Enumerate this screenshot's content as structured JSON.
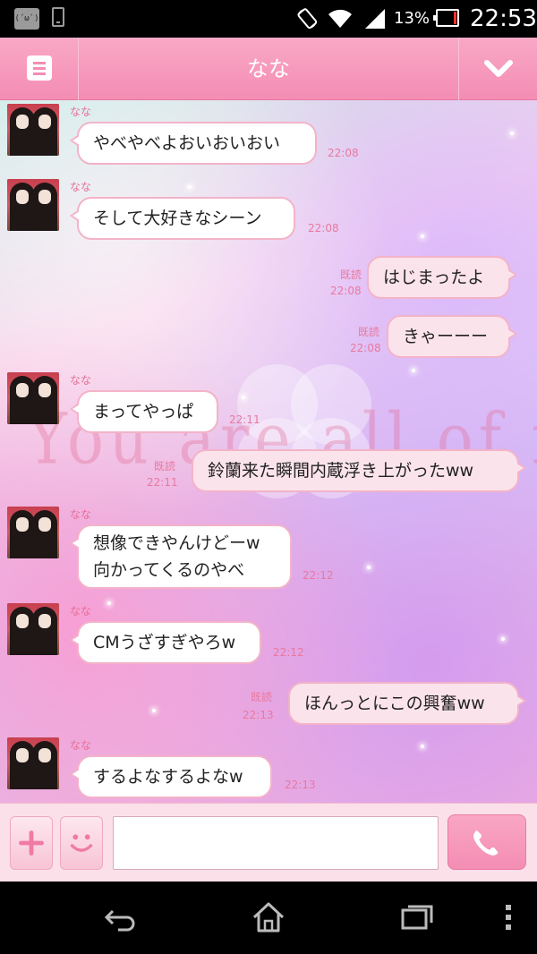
{
  "status_bar": {
    "face_icon_text": "(´ω`)",
    "battery_percent": "13%",
    "time": "22:53",
    "icons": [
      "face-notification-icon",
      "phone-icon",
      "rotate-icon",
      "wifi-icon",
      "signal-icon",
      "battery-icon"
    ]
  },
  "header": {
    "title": "なな",
    "menu_icon": "menu-icon",
    "dropdown_icon": "chevron-down-icon"
  },
  "chat": {
    "watermark_text": "You are all of me",
    "messages": [
      {
        "direction": "in",
        "sender": "なな",
        "lines": [
          "やべやべよおいおいおい"
        ],
        "time": "22:08"
      },
      {
        "direction": "in",
        "sender": "なな",
        "lines": [
          "そして大好きなシーン"
        ],
        "time": "22:08"
      },
      {
        "direction": "out",
        "read": "既読",
        "lines": [
          "はじまったよ"
        ],
        "time": "22:08"
      },
      {
        "direction": "out",
        "read": "既読",
        "lines": [
          "きゃーーー"
        ],
        "time": "22:08"
      },
      {
        "direction": "in",
        "sender": "なな",
        "lines": [
          "まってやっぱ"
        ],
        "time": "22:11"
      },
      {
        "direction": "out",
        "read": "既読",
        "lines": [
          "鈴蘭来た瞬間内蔵浮き上がったww"
        ],
        "time": "22:11"
      },
      {
        "direction": "in",
        "sender": "なな",
        "lines": [
          "想像できやんけどーw",
          "向かってくるのやべ"
        ],
        "time": "22:12"
      },
      {
        "direction": "in",
        "sender": "なな",
        "lines": [
          "CMうざすぎやろw"
        ],
        "time": "22:12"
      },
      {
        "direction": "out",
        "read": "既読",
        "lines": [
          "ほんっとにこの興奮ww"
        ],
        "time": "22:13"
      },
      {
        "direction": "in",
        "sender": "なな",
        "lines": [
          "するよなするよなw"
        ],
        "time": "22:13"
      }
    ]
  },
  "input_bar": {
    "plus_icon": "plus-icon",
    "emoji_icon": "smiley-icon",
    "text_value": "",
    "call_icon": "phone-call-icon"
  },
  "nav_bar": {
    "icons": [
      "back-icon",
      "home-icon",
      "recent-apps-icon",
      "overflow-menu-icon"
    ]
  },
  "colors": {
    "accent_pink": "#f48db3",
    "bubble_border": "#f3b3c8",
    "timestamp": "#e8799f"
  }
}
